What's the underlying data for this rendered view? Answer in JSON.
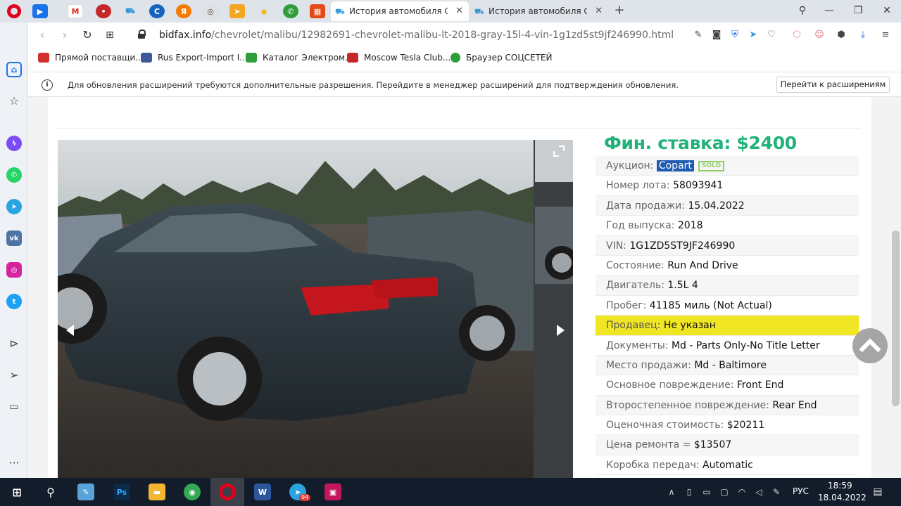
{
  "tabs": [
    {
      "label": "История автомобиля Chevr"
    },
    {
      "label": "История автомобиля Chevr"
    }
  ],
  "address": {
    "domain": "bidfax.info",
    "path": "/chevrolet/malibu/12982691-chevrolet-malibu-lt-2018-gray-15l-4-vin-1g1zd5st9jf246990.html"
  },
  "bookmarks": [
    {
      "label": "Прямой поставщи...",
      "color": "#d32f2f"
    },
    {
      "label": "Rus Export-Import I...",
      "color": "#3b5998"
    },
    {
      "label": "Каталог Электром...",
      "color": "#2e9d3a"
    },
    {
      "label": "Moscow Tesla Club...",
      "color": "#c62828"
    },
    {
      "label": "Браузер СОЦСЕТЕЙ",
      "color": "#2e9d3a"
    }
  ],
  "notification": {
    "text": "Для обновления расширений требуются дополнительные разрешения. Перейдите в менеджер расширений для подтверждения обновления.",
    "button": "Перейти к расширениям"
  },
  "lot": {
    "price": "Фин. ставка: $2400",
    "auction_label": "Аукцион:",
    "auction_value": "Copart",
    "sold_badge": "SOLD",
    "rows": [
      {
        "label": "Номер лота:",
        "value": "58093941"
      },
      {
        "label": "Дата продажи:",
        "value": "15.04.2022"
      },
      {
        "label": "Год выпуска:",
        "value": "2018"
      },
      {
        "label": "VIN:",
        "value": "1G1ZD5ST9JF246990"
      },
      {
        "label": "Состояние:",
        "value": "Run And Drive"
      },
      {
        "label": "Двигатель:",
        "value": "1.5L 4"
      },
      {
        "label": "Пробег:",
        "value": "41185 миль (Not Actual)"
      },
      {
        "label": "Продавец:",
        "value": "Не указан",
        "highlight": true
      },
      {
        "label": "Документы:",
        "value": "Md - Parts Only-No Title Letter"
      },
      {
        "label": "Место продажи:",
        "value": "Md - Baltimore"
      },
      {
        "label": "Основное повреждение:",
        "value": "Front End"
      },
      {
        "label": "Второстепенное повреждение:",
        "value": "Rear End"
      },
      {
        "label": "Оценочная стоимость:",
        "value": "$20211"
      },
      {
        "label": "Цена ремонта ≈",
        "value": "$13507"
      },
      {
        "label": "Коробка передач:",
        "value": "Automatic"
      }
    ]
  },
  "taskbar": {
    "language": "РУС",
    "time": "18:59",
    "date": "18.04.2022",
    "telegram_badge": "94"
  },
  "colors": {
    "price_green": "#20b27a",
    "highlight_yellow": "#f1e624",
    "copart_blue": "#1f5ab3"
  }
}
